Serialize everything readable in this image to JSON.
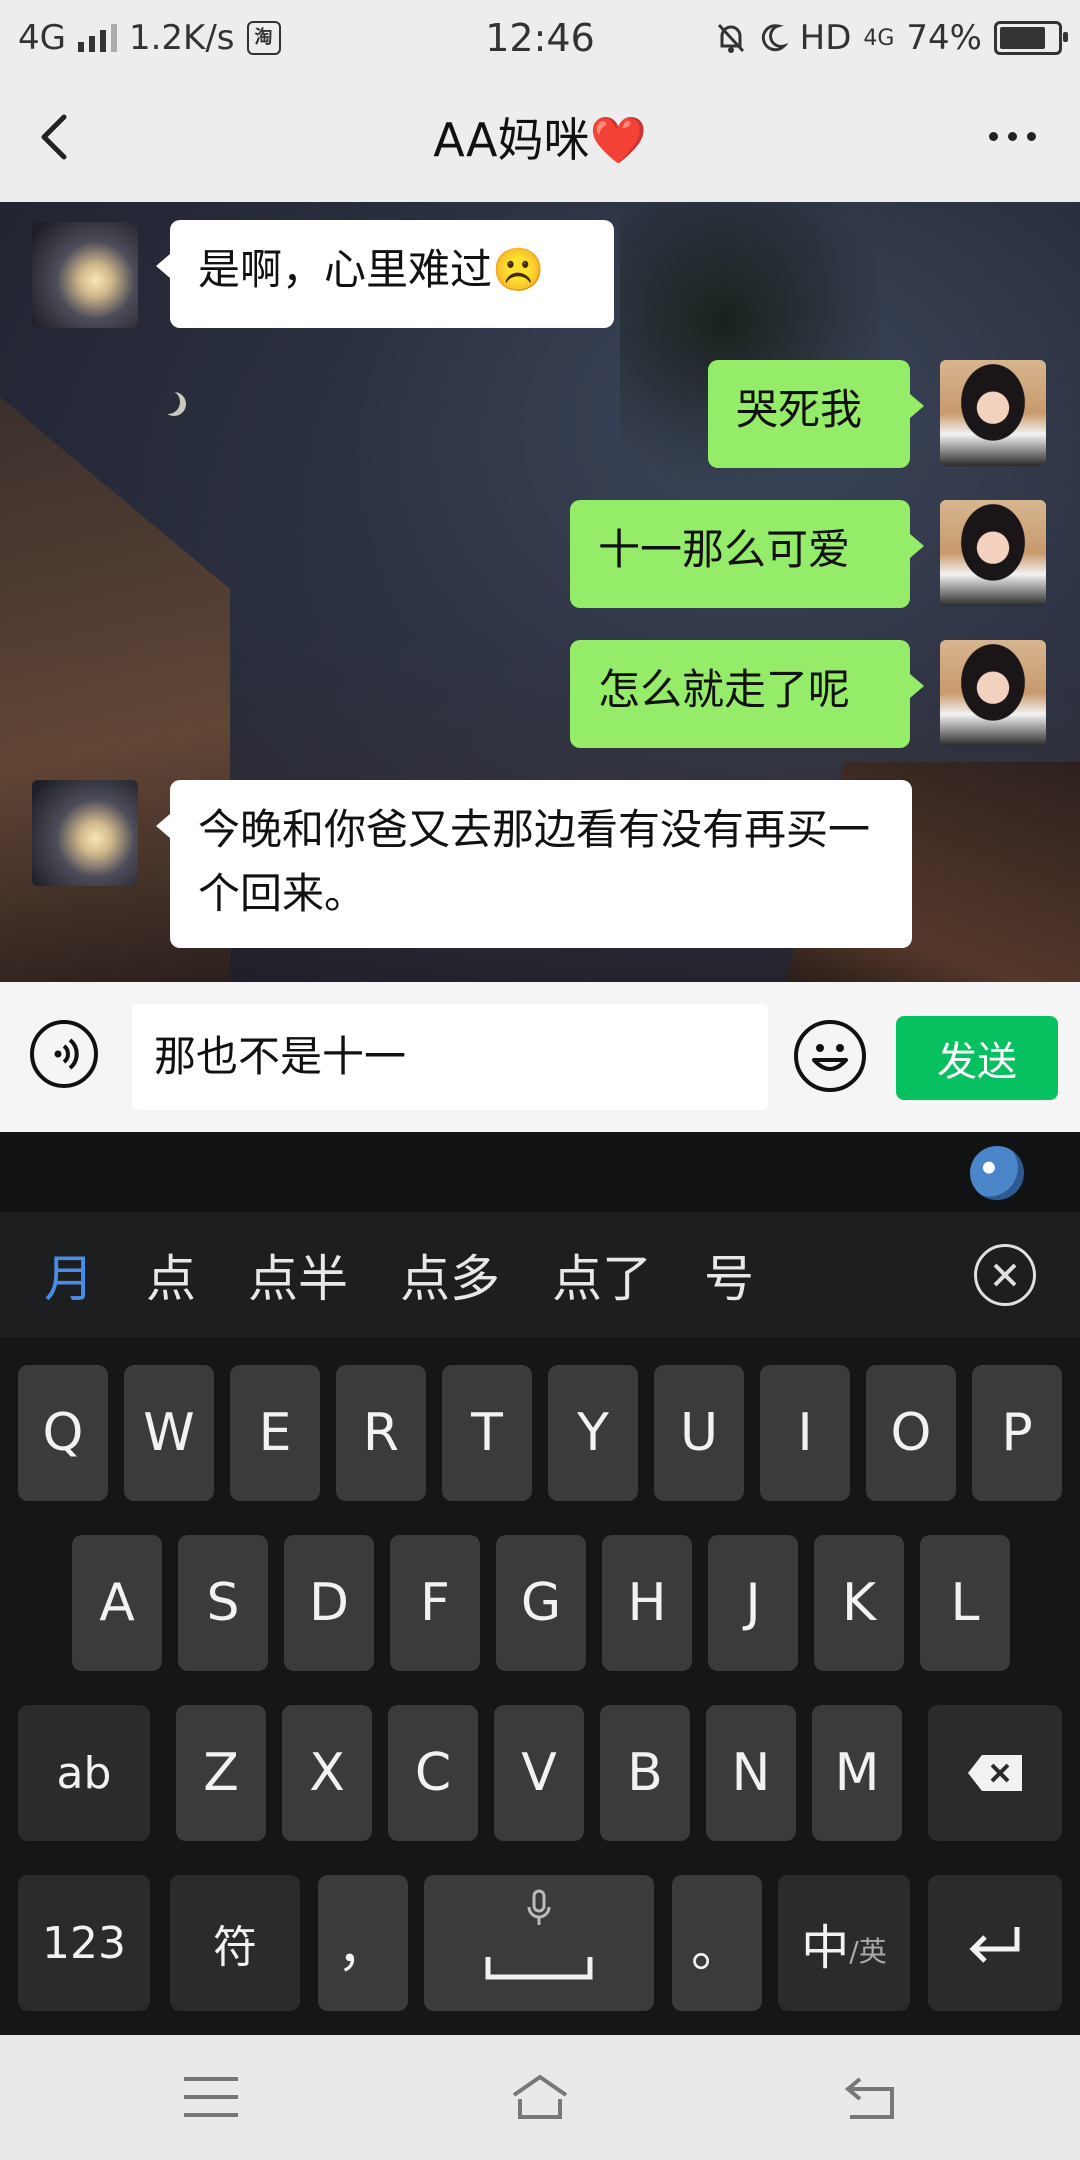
{
  "status_bar": {
    "network": "4G",
    "speed": "1.2K/s",
    "taobao": "淘",
    "time": "12:46",
    "hd": "HD",
    "net2": "4G",
    "battery": "74%"
  },
  "header": {
    "title": "AA妈咪❤️"
  },
  "messages": [
    {
      "side": "left",
      "text": "是啊，心里难过☹️"
    },
    {
      "side": "right",
      "text": "哭死我"
    },
    {
      "side": "right",
      "text": "十一那么可爱"
    },
    {
      "side": "right",
      "text": "怎么就走了呢"
    },
    {
      "side": "left",
      "text": "今晚和你爸又去那边看有没有再买一个回来。"
    }
  ],
  "input": {
    "text": "那也不是十一",
    "send_label": "发送"
  },
  "keyboard": {
    "candidates": [
      "月",
      "点",
      "点半",
      "点多",
      "点了",
      "号"
    ],
    "row1": [
      "Q",
      "W",
      "E",
      "R",
      "T",
      "Y",
      "U",
      "I",
      "O",
      "P"
    ],
    "row2": [
      "A",
      "S",
      "D",
      "F",
      "G",
      "H",
      "J",
      "K",
      "L"
    ],
    "row3": [
      "ab",
      "Z",
      "X",
      "C",
      "V",
      "B",
      "N",
      "M"
    ],
    "row4": {
      "num": "123",
      "sym": "符",
      "comma": "，",
      "period": "。",
      "lang_main": "中",
      "lang_sub": "/英"
    }
  },
  "colors": {
    "send_green": "#07c160",
    "bubble_green": "#95ec69",
    "candidate_blue": "#4a8de6"
  }
}
